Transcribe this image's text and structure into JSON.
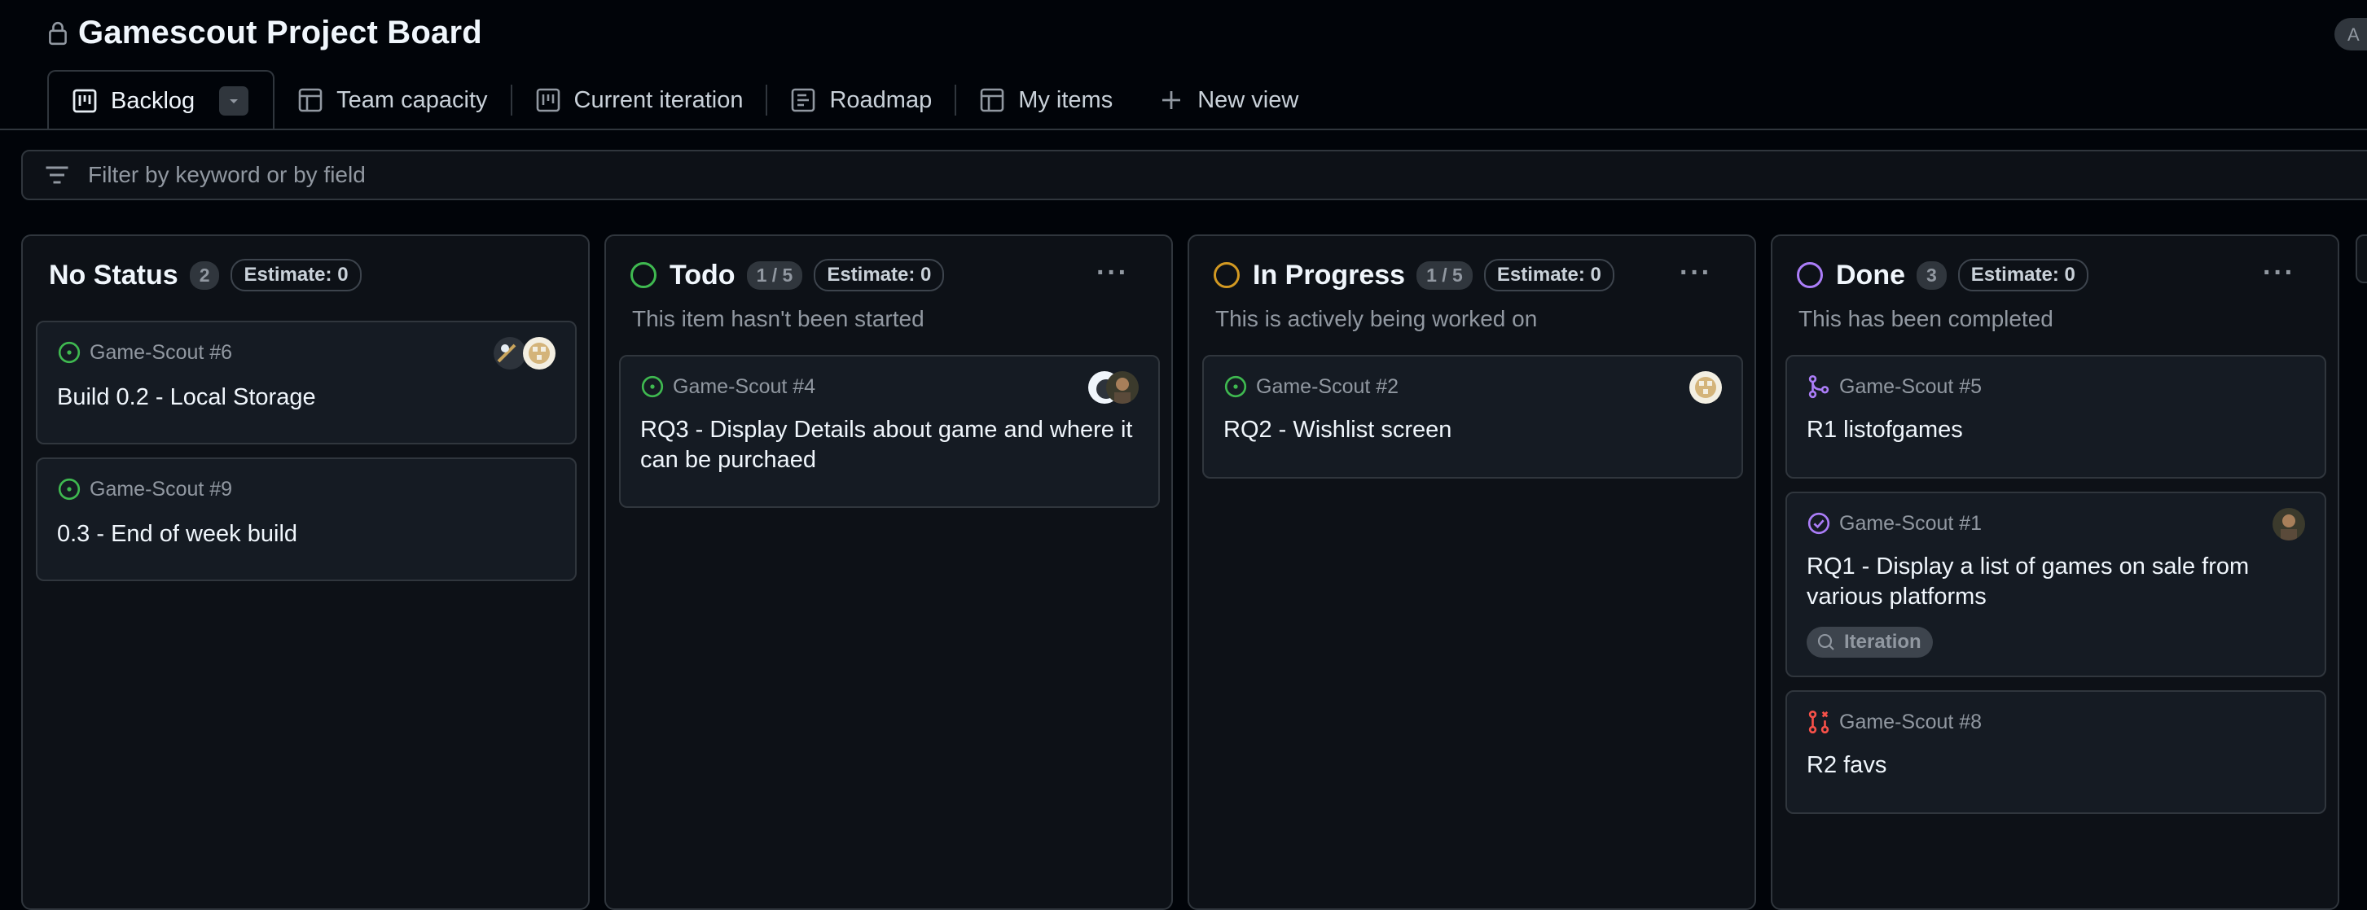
{
  "header": {
    "title": "Gamescout Project Board",
    "corner_label": "A"
  },
  "tabs": [
    {
      "label": "Backlog",
      "icon": "board-icon"
    },
    {
      "label": "Team capacity",
      "icon": "table-icon"
    },
    {
      "label": "Current iteration",
      "icon": "board-icon"
    },
    {
      "label": "Roadmap",
      "icon": "roadmap-icon"
    },
    {
      "label": "My items",
      "icon": "table-icon"
    },
    {
      "label": "New view",
      "icon": "plus-icon"
    }
  ],
  "filter": {
    "placeholder": "Filter by keyword or by field"
  },
  "columns": [
    {
      "title": "No Status",
      "count": "2",
      "estimate": "Estimate: 0",
      "description": "",
      "cards": [
        {
          "ref": "Game-Scout #6",
          "title": "Build 0.2 - Local Storage",
          "state": "open-issue"
        },
        {
          "ref": "Game-Scout #9",
          "title": "0.3 - End of week build",
          "state": "open-issue"
        }
      ]
    },
    {
      "title": "Todo",
      "count": "1 / 5",
      "estimate": "Estimate: 0",
      "description": "This item hasn't been started",
      "status_color": "#3fb950",
      "cards": [
        {
          "ref": "Game-Scout #4",
          "title": "RQ3 - Display Details about game and where it can be purchaed",
          "state": "open-issue"
        }
      ]
    },
    {
      "title": "In Progress",
      "count": "1 / 5",
      "estimate": "Estimate: 0",
      "description": "This is actively being worked on",
      "status_color": "#d29922",
      "cards": [
        {
          "ref": "Game-Scout #2",
          "title": "RQ2 - Wishlist screen",
          "state": "open-issue"
        }
      ]
    },
    {
      "title": "Done",
      "count": "3",
      "estimate": "Estimate: 0",
      "description": "This has been completed",
      "status_color": "#ab7df8",
      "cards": [
        {
          "ref": "Game-Scout #5",
          "title": "R1 listofgames",
          "state": "merged-pr"
        },
        {
          "ref": "Game-Scout #1",
          "title": "RQ1 - Display a list of games on sale from various platforms",
          "state": "closed-issue",
          "tag": "Iteration"
        },
        {
          "ref": "Game-Scout #8",
          "title": "R2 favs",
          "state": "closed-pr"
        }
      ]
    }
  ],
  "colors": {
    "background": "#010409",
    "column_bg": "#0d1117",
    "card_bg": "#151b23",
    "border": "#30363d",
    "open_green": "#3fb950",
    "done_purple": "#ab7df8",
    "closed_red": "#f85149",
    "progress_yellow": "#d29922"
  }
}
